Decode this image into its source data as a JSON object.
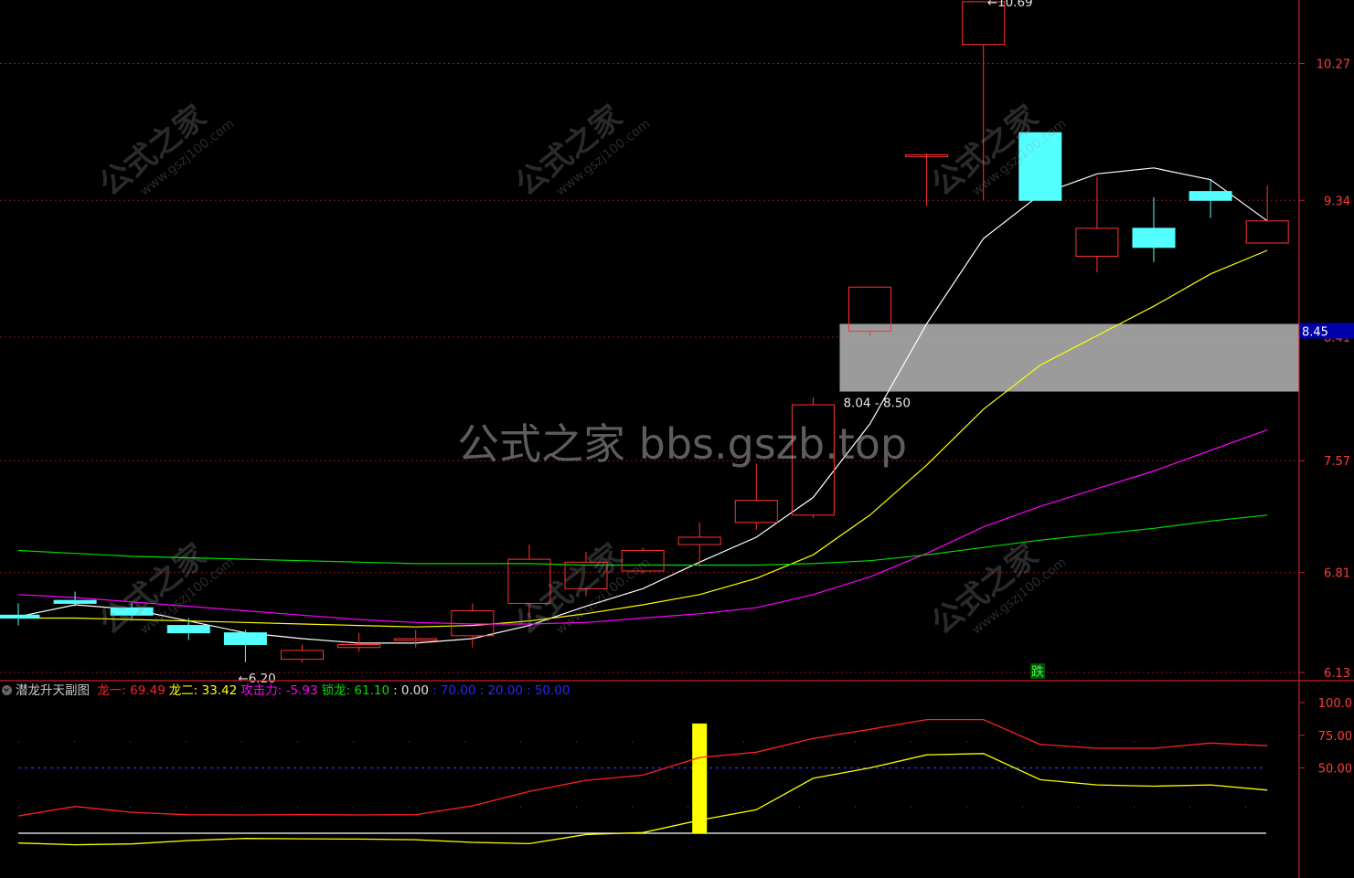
{
  "chart_data": [
    {
      "type": "candlestick",
      "title": "",
      "price_axis": {
        "ylim": [
          6.0,
          10.75
        ],
        "tick_labels": [
          "10.27",
          "9.34",
          "8.41",
          "7.57",
          "6.81",
          "6.13"
        ],
        "current_price_label": "8.45",
        "grid": true
      },
      "candles": [
        {
          "open": 6.52,
          "high": 6.6,
          "low": 6.45,
          "close": 6.5
        },
        {
          "open": 6.62,
          "high": 6.68,
          "low": 6.58,
          "close": 6.6
        },
        {
          "open": 6.57,
          "high": 6.6,
          "low": 6.5,
          "close": 6.52
        },
        {
          "open": 6.45,
          "high": 6.5,
          "low": 6.35,
          "close": 6.4
        },
        {
          "open": 6.4,
          "high": 6.42,
          "low": 6.2,
          "close": 6.32
        },
        {
          "open": 6.22,
          "high": 6.32,
          "low": 6.2,
          "close": 6.28
        },
        {
          "open": 6.3,
          "high": 6.4,
          "low": 6.27,
          "close": 6.32
        },
        {
          "open": 6.35,
          "high": 6.42,
          "low": 6.3,
          "close": 6.36
        },
        {
          "open": 6.38,
          "high": 6.6,
          "low": 6.3,
          "close": 6.55
        },
        {
          "open": 6.6,
          "high": 7.0,
          "low": 6.5,
          "close": 6.9
        },
        {
          "open": 6.7,
          "high": 6.95,
          "low": 6.65,
          "close": 6.88
        },
        {
          "open": 6.82,
          "high": 6.98,
          "low": 6.8,
          "close": 6.96
        },
        {
          "open": 7.0,
          "high": 7.15,
          "low": 6.85,
          "close": 7.05
        },
        {
          "open": 7.15,
          "high": 7.55,
          "low": 7.1,
          "close": 7.3
        },
        {
          "open": 7.2,
          "high": 8.0,
          "low": 7.18,
          "close": 7.95
        },
        {
          "open": 8.45,
          "high": 8.75,
          "low": 8.42,
          "close": 8.75
        },
        {
          "open": 9.65,
          "high": 9.66,
          "low": 9.3,
          "close": 9.65
        },
        {
          "open": 10.4,
          "high": 10.69,
          "low": 9.34,
          "close": 10.69
        },
        {
          "open": 9.8,
          "high": 9.8,
          "low": 9.34,
          "close": 9.34
        },
        {
          "open": 8.96,
          "high": 9.5,
          "low": 8.85,
          "close": 9.15
        },
        {
          "open": 9.15,
          "high": 9.36,
          "low": 8.92,
          "close": 9.02
        },
        {
          "open": 9.4,
          "high": 9.48,
          "low": 9.22,
          "close": 9.34
        },
        {
          "open": 9.05,
          "high": 9.44,
          "low": 9.05,
          "close": 9.2
        }
      ],
      "up_color": "#ff3232",
      "down_color": "#54ffff",
      "ma_lines": [
        {
          "color": "#ffffff",
          "values": [
            6.51,
            6.59,
            6.56,
            6.48,
            6.4,
            6.36,
            6.33,
            6.33,
            6.36,
            6.45,
            6.58,
            6.7,
            6.88,
            7.05,
            7.32,
            7.82,
            8.5,
            9.08,
            9.38,
            9.52,
            9.56,
            9.48,
            9.2
          ]
        },
        {
          "color": "#ffff00",
          "values": [
            6.5,
            6.5,
            6.49,
            6.48,
            6.47,
            6.46,
            6.45,
            6.44,
            6.45,
            6.48,
            6.53,
            6.59,
            6.66,
            6.77,
            6.93,
            7.2,
            7.54,
            7.92,
            8.22,
            8.42,
            8.62,
            8.84,
            9.0
          ]
        },
        {
          "color": "#ff00ff",
          "values": [
            6.66,
            6.64,
            6.61,
            6.58,
            6.55,
            6.52,
            6.49,
            6.47,
            6.46,
            6.46,
            6.47,
            6.5,
            6.53,
            6.57,
            6.66,
            6.78,
            6.94,
            7.12,
            7.26,
            7.38,
            7.5,
            7.64,
            7.78
          ]
        },
        {
          "color": "#00dd00",
          "values": [
            6.96,
            6.94,
            6.92,
            6.91,
            6.9,
            6.89,
            6.88,
            6.87,
            6.87,
            6.87,
            6.86,
            6.86,
            6.86,
            6.86,
            6.87,
            6.89,
            6.93,
            6.98,
            7.03,
            7.07,
            7.11,
            7.16,
            7.2
          ]
        }
      ],
      "zone": {
        "low": 8.04,
        "high": 8.5,
        "label": "8.04 - 8.50",
        "start_index": 14.5
      },
      "annotations": {
        "high": "10.69",
        "low": "6.20",
        "fall_marker": "跌"
      }
    },
    {
      "type": "line",
      "title": "潜龙升天副图",
      "ylim": [
        -10,
        110
      ],
      "tick_labels": [
        "100.0",
        "75.00",
        "50.00"
      ],
      "legend": [
        {
          "name": "龙一",
          "value": "69.49",
          "color": "#ff2020"
        },
        {
          "name": "龙二",
          "value": "33.42",
          "color": "#ffff00"
        },
        {
          "name": "攻击力",
          "value": "-5.93",
          "color": "#ff00ff"
        },
        {
          "name": "锁龙",
          "value": "61.10",
          "color": "#00dd00"
        }
      ],
      "extra_values": [
        {
          "text": ": 0.00",
          "color": "#e0e0e0"
        },
        {
          "text": ": 70.00",
          "color": "#2828ff"
        },
        {
          "text": ": 20.00",
          "color": "#2828ff"
        },
        {
          "text": ": 50.00",
          "color": "#2828ff"
        }
      ],
      "series": [
        {
          "name": "龙一",
          "color": "#ff2020",
          "values": [
            13.2,
            20.5,
            16.0,
            14.1,
            14.0,
            14.2,
            14.0,
            14.2,
            21.0,
            32.0,
            40.5,
            44.5,
            58.0,
            62.0,
            72.5,
            79.5,
            87.0,
            87.0,
            68.0,
            65.0,
            65.0,
            69.0,
            67.0
          ]
        },
        {
          "name": "龙二",
          "color": "#ffff00",
          "values": [
            -7.5,
            -8.8,
            -8.2,
            -5.6,
            -4.0,
            -4.3,
            -4.5,
            -5.0,
            -7.0,
            -8.0,
            -1.0,
            0.5,
            10.0,
            18.0,
            42.0,
            50.0,
            60.0,
            61.0,
            41.0,
            37.0,
            36.0,
            37.0,
            33.0
          ]
        }
      ],
      "baseline": 0,
      "dotted_levels": [
        50,
        70,
        20
      ],
      "signal_bar": {
        "index": 12,
        "from": 0,
        "to": 84,
        "color": "#ffff00"
      }
    }
  ],
  "watermarks": {
    "main": "公式之家 bbs.gszb.top",
    "stamp_cn": "公式之家",
    "stamp_en": "www.gszj100.com"
  }
}
